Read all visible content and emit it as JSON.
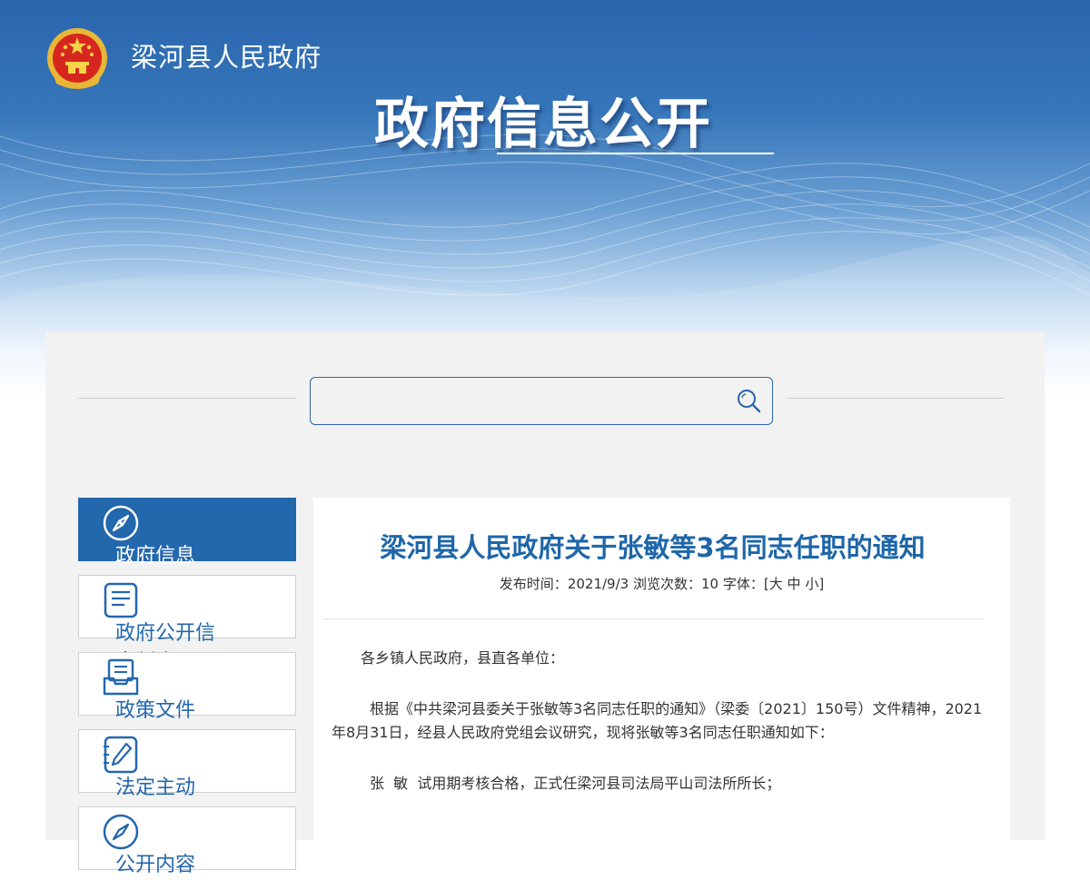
{
  "header": {
    "site_name": "梁河县人民政府",
    "main_title": "政府信息公开"
  },
  "search": {
    "placeholder": "",
    "icon": "search-icon"
  },
  "sidebar": {
    "items": [
      {
        "label": "政府信息",
        "icon": "compass-icon",
        "active": true
      },
      {
        "label": "政府公开信息制度",
        "icon": "document-list-icon",
        "active": false
      },
      {
        "label": "政策文件",
        "icon": "inbox-tray-icon",
        "active": false
      },
      {
        "label": "法定主动",
        "icon": "edit-pen-icon",
        "active": false
      },
      {
        "label": "公开内容",
        "icon": "compass-icon",
        "active": false
      }
    ]
  },
  "article": {
    "title": "梁河县人民政府关于张敏等3名同志任职的通知",
    "meta": {
      "publish_label": "发布时间：",
      "publish_date": "2021/9/3",
      "views_label": "浏览次数：",
      "views_count": "10",
      "font_label": "字体：[",
      "font_large": "大",
      "font_medium": "中",
      "font_small": "小",
      "font_close": "]"
    },
    "paragraphs": [
      "各乡镇人民政府，县直各单位：",
      "根据《中共梁河县委关于张敏等3名同志任职的通知》（梁委〔2021〕150号）文件精神，2021年8月31日，经县人民政府党组会议研究，现将张敏等3名同志任职通知如下：",
      "张  敏  试用期考核合格，正式任梁河县司法局平山司法所所长；"
    ]
  },
  "colors": {
    "brand_blue": "#2367ad",
    "title_blue": "#1e66a8",
    "panel_bg": "#f2f2f2"
  }
}
